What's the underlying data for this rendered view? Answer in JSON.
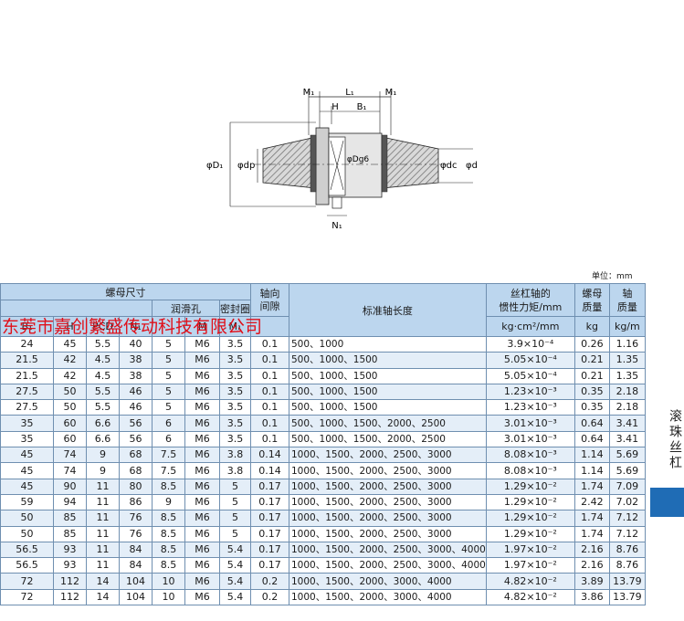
{
  "drawing": {
    "labels": {
      "m1_left": "M₁",
      "l1": "L₁",
      "m1_right": "M₁",
      "h": "H",
      "b1": "B₁",
      "d1": "φD₁",
      "dp": "φdp",
      "dg6": "φDg6",
      "dc": "φdc",
      "d": "φd",
      "n1": "N₁"
    }
  },
  "unit_label": "单位：mm",
  "header": {
    "nut_size": "螺母尺寸",
    "lube_hole": "润滑孔",
    "seal": "密封圈",
    "axial": "轴向",
    "axial2": "间隙",
    "std_length": "标准轴长度",
    "inertia_1": "丝杠轴的",
    "inertia_2": "惯性力矩/mm",
    "inertia_unit": "kg·cm²/mm",
    "nut_mass_1": "螺母",
    "nut_mass_2": "质量",
    "nut_mass_unit": "kg",
    "shaft_mass_1": "轴",
    "shaft_mass_2": "质量",
    "shaft_mass_unit": "kg/m",
    "sub_b1": "B₁",
    "sub_h": "H",
    "sub_pcd": "PCD",
    "sub_n1": "N₁",
    "sub_m": "M",
    "sub_seal": "M₁"
  },
  "watermark": "东莞市嘉创繁盛传动科技有限公司",
  "side_title": "滚珠丝杠",
  "rows": [
    [
      "24",
      "45",
      "5.5",
      "40",
      "5",
      "M6",
      "3.5",
      "0.1",
      "500、1000",
      "3.9×10⁻⁴",
      "0.26",
      "1.16"
    ],
    [
      "21.5",
      "42",
      "4.5",
      "38",
      "5",
      "M6",
      "3.5",
      "0.1",
      "500、1000、1500",
      "5.05×10⁻⁴",
      "0.21",
      "1.35"
    ],
    [
      "21.5",
      "42",
      "4.5",
      "38",
      "5",
      "M6",
      "3.5",
      "0.1",
      "500、1000、1500",
      "5.05×10⁻⁴",
      "0.21",
      "1.35"
    ],
    [
      "27.5",
      "50",
      "5.5",
      "46",
      "5",
      "M6",
      "3.5",
      "0.1",
      "500、1000、1500",
      "1.23×10⁻³",
      "0.35",
      "2.18"
    ],
    [
      "27.5",
      "50",
      "5.5",
      "46",
      "5",
      "M6",
      "3.5",
      "0.1",
      "500、1000、1500",
      "1.23×10⁻³",
      "0.35",
      "2.18"
    ],
    [
      "35",
      "60",
      "6.6",
      "56",
      "6",
      "M6",
      "3.5",
      "0.1",
      "500、1000、1500、2000、2500",
      "3.01×10⁻³",
      "0.64",
      "3.41"
    ],
    [
      "35",
      "60",
      "6.6",
      "56",
      "6",
      "M6",
      "3.5",
      "0.1",
      "500、1000、1500、2000、2500",
      "3.01×10⁻³",
      "0.64",
      "3.41"
    ],
    [
      "45",
      "74",
      "9",
      "68",
      "7.5",
      "M6",
      "3.8",
      "0.14",
      "1000、1500、2000、2500、3000",
      "8.08×10⁻³",
      "1.14",
      "5.69"
    ],
    [
      "45",
      "74",
      "9",
      "68",
      "7.5",
      "M6",
      "3.8",
      "0.14",
      "1000、1500、2000、2500、3000",
      "8.08×10⁻³",
      "1.14",
      "5.69"
    ],
    [
      "45",
      "90",
      "11",
      "80",
      "8.5",
      "M6",
      "5",
      "0.17",
      "1000、1500、2000、2500、3000",
      "1.29×10⁻²",
      "1.74",
      "7.09"
    ],
    [
      "59",
      "94",
      "11",
      "86",
      "9",
      "M6",
      "5",
      "0.17",
      "1000、1500、2000、2500、3000",
      "1.29×10⁻²",
      "2.42",
      "7.02"
    ],
    [
      "50",
      "85",
      "11",
      "76",
      "8.5",
      "M6",
      "5",
      "0.17",
      "1000、1500、2000、2500、3000",
      "1.29×10⁻²",
      "1.74",
      "7.12"
    ],
    [
      "50",
      "85",
      "11",
      "76",
      "8.5",
      "M6",
      "5",
      "0.17",
      "1000、1500、2000、2500、3000",
      "1.29×10⁻²",
      "1.74",
      "7.12"
    ],
    [
      "56.5",
      "93",
      "11",
      "84",
      "8.5",
      "M6",
      "5.4",
      "0.17",
      "1000、1500、2000、2500、3000、4000",
      "1.97×10⁻²",
      "2.16",
      "8.76"
    ],
    [
      "56.5",
      "93",
      "11",
      "84",
      "8.5",
      "M6",
      "5.4",
      "0.17",
      "1000、1500、2000、2500、3000、4000",
      "1.97×10⁻²",
      "2.16",
      "8.76"
    ],
    [
      "72",
      "112",
      "14",
      "104",
      "10",
      "M6",
      "5.4",
      "0.2",
      "1000、1500、2000、3000、4000",
      "4.82×10⁻²",
      "3.89",
      "13.79"
    ],
    [
      "72",
      "112",
      "14",
      "104",
      "10",
      "M6",
      "5.4",
      "0.2",
      "1000、1500、2000、3000、4000",
      "4.82×10⁻²",
      "3.86",
      "13.79"
    ]
  ]
}
